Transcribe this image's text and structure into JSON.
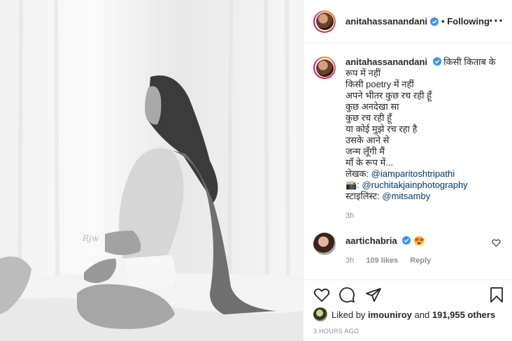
{
  "post": {
    "username": "anitahassanandani",
    "follow_status": "Following",
    "separator": "•",
    "more_icon": "more-dots-icon"
  },
  "caption": {
    "username": "anitahassanandani",
    "lines": [
      "किसी किताब के",
      "रूप में नहीं",
      "किसी poetry में नहीं",
      "अपने भीतर कुछ रच रही हूँ",
      "कुछ अनदेखा सा",
      "कुछ रच रही हूँ",
      "या कोई मुझे रच रहा है",
      "उसके आने से",
      "जन्म लूँगी मैं",
      "माँ के रूप में..."
    ],
    "writer_label": "लेखक:",
    "writer_handle": "@iamparitoshtripathi",
    "camera_emoji": "📸:",
    "photographer_handle": "@ruchitakjainphotography",
    "stylist_label": "स्टाइलिस्ट:",
    "stylist_handle": "@mitsamby",
    "time": "3h"
  },
  "comment": {
    "username": "aartichabria",
    "emoji": "😍",
    "time": "3h",
    "likes": "109 likes",
    "reply": "Reply"
  },
  "likes": {
    "prefix": "Liked by",
    "user": "imouniroy",
    "middle": "and",
    "count": "191,955 others"
  },
  "post_time": "3 HOURS AGO",
  "colors": {
    "verified": "#3897f0",
    "link": "#00376b",
    "muted": "#8e8e8e"
  }
}
